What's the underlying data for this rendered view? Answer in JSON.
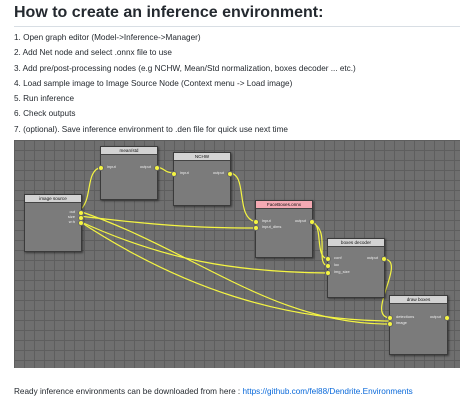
{
  "heading": "How to create an inference environment:",
  "steps": [
    "1. Open graph editor (Model->Inference->Manager)",
    "2. Add Net node and select .onnx file to use",
    "3. Add pre/post-processing nodes (e.g NCHW, Mean/Std normalization, boxes decoder ... etc.)",
    "4. Load sample image to Image Source Node (Context menu -> Load image)",
    "5. Run inference",
    "6. Check outputs",
    "7. (optional). Save inference environment to .den file for quick use next time"
  ],
  "graph": {
    "nodes": {
      "image_source": {
        "title": "image source",
        "ports_out": [
          "out",
          "size",
          "w:h"
        ]
      },
      "meanstd": {
        "title": "mean/std",
        "port_in": "input",
        "port_out": "output"
      },
      "nchw": {
        "title": "NCHW",
        "port_in": "input",
        "port_out": "output"
      },
      "faceboxes": {
        "title": "FaceBoxes.onnx",
        "ports_in": [
          "input",
          "input_dims"
        ],
        "port_out": "output"
      },
      "boxes_decoder": {
        "title": "boxes decoder",
        "ports_in": [
          "conf",
          "loc",
          "img_size"
        ],
        "port_out": "output"
      },
      "draw_boxes": {
        "title": "draw boxes",
        "ports_in": [
          "detections",
          "image"
        ],
        "port_out": "output"
      }
    },
    "wire_color": "#f5f542",
    "background": "#6f6f6f"
  },
  "footer": {
    "text": "Ready inference environments can be downloaded from here : ",
    "link": "https://github.com/fel88/Dendrite.Environments"
  }
}
